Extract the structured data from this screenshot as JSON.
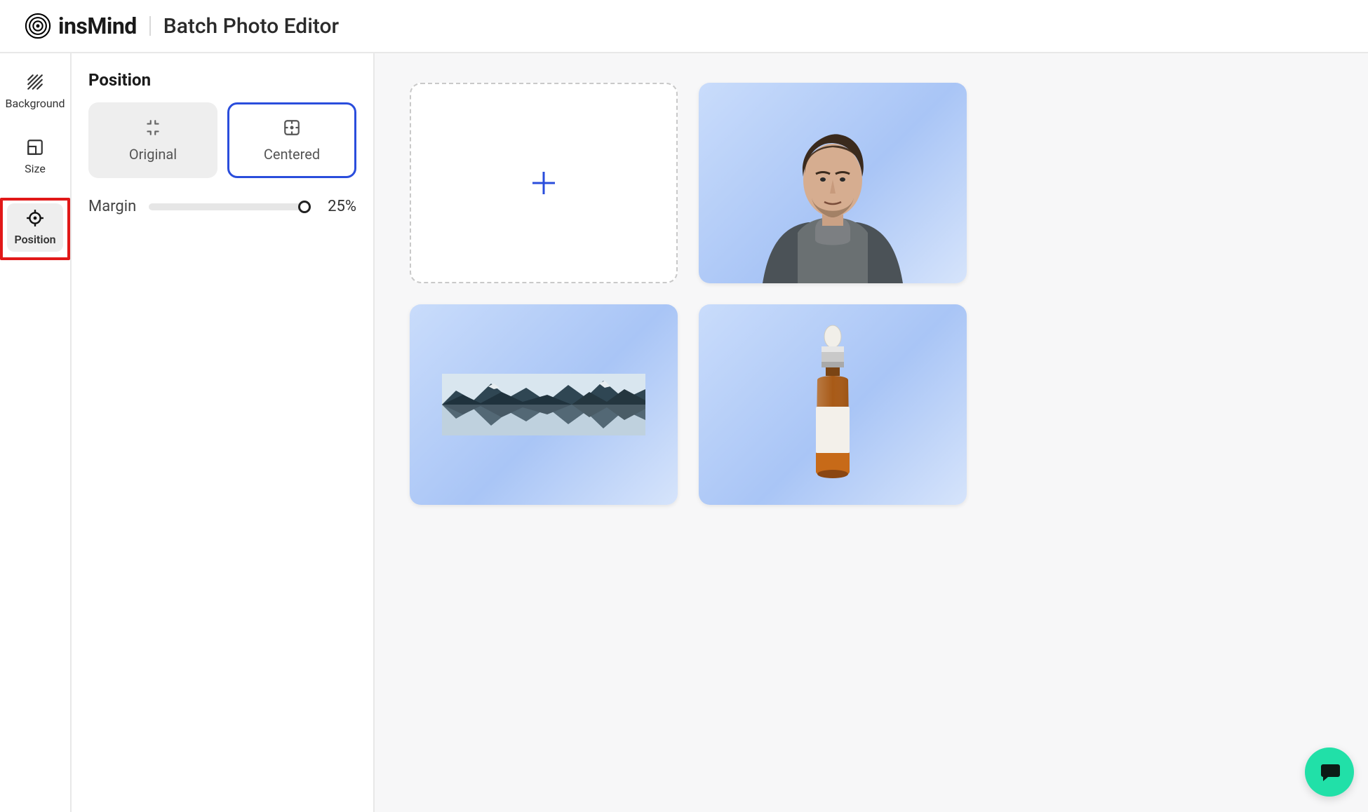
{
  "header": {
    "brand": "insMind",
    "title": "Batch Photo Editor"
  },
  "sidebar": {
    "items": [
      {
        "label": "Background",
        "icon": "hatch-icon",
        "active": false
      },
      {
        "label": "Size",
        "icon": "resize-icon",
        "active": false
      },
      {
        "label": "Position",
        "icon": "crosshair-icon",
        "active": true,
        "highlighted": true
      }
    ]
  },
  "panel": {
    "heading": "Position",
    "options": [
      {
        "label": "Original",
        "icon": "collapse-icon",
        "selected": false
      },
      {
        "label": "Centered",
        "icon": "center-frame-icon",
        "selected": true
      }
    ],
    "margin": {
      "label": "Margin",
      "value_text": "25%",
      "value_percent": 100
    }
  },
  "canvas": {
    "tiles": [
      {
        "kind": "add"
      },
      {
        "kind": "photo",
        "subject": "portrait-man"
      },
      {
        "kind": "photo",
        "subject": "mountain-landscape"
      },
      {
        "kind": "photo",
        "subject": "dropper-bottle"
      }
    ]
  },
  "chat": {
    "name": "chat-support"
  }
}
